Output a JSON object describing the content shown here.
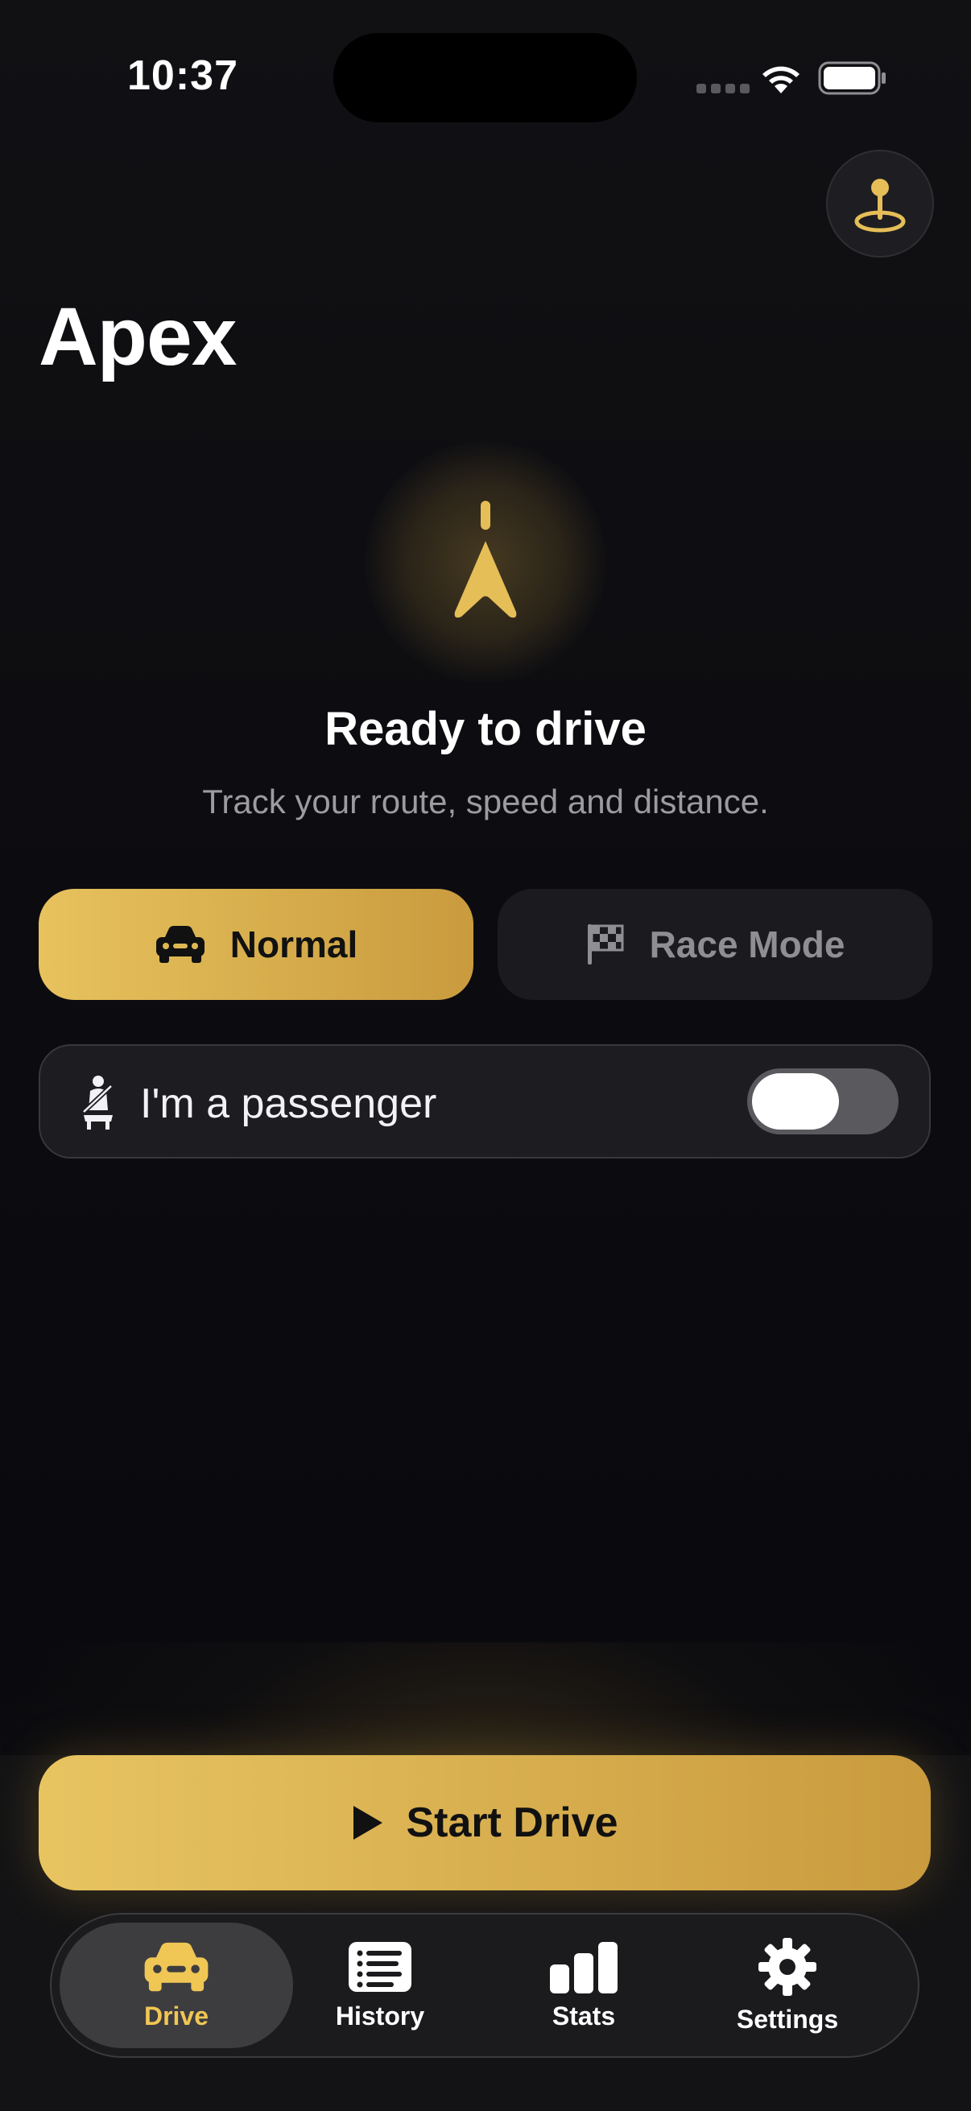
{
  "status_bar": {
    "time": "10:37",
    "icons": [
      "cellular-signal-icon",
      "wifi-icon",
      "battery-icon"
    ]
  },
  "header": {
    "app_title": "Apex",
    "map_button_icon": "map-pin-icon"
  },
  "hero": {
    "icon": "navigation-arrow-icon",
    "title": "Ready to drive",
    "subtitle": "Track your route, speed and distance."
  },
  "mode_selector": {
    "options": [
      {
        "label": "Normal",
        "icon": "car-icon",
        "selected": true
      },
      {
        "label": "Race Mode",
        "icon": "checkered-flag-icon",
        "selected": false
      }
    ]
  },
  "passenger": {
    "label": "I'm a passenger",
    "icon": "seatbelt-icon",
    "enabled": false
  },
  "start_button": {
    "label": "Start Drive",
    "icon": "play-icon"
  },
  "tabbar": {
    "tabs": [
      {
        "label": "Drive",
        "icon": "car-icon",
        "active": true
      },
      {
        "label": "History",
        "icon": "list-icon",
        "active": false
      },
      {
        "label": "Stats",
        "icon": "bar-chart-icon",
        "active": false
      },
      {
        "label": "Settings",
        "icon": "gear-icon",
        "active": false
      }
    ]
  },
  "colors": {
    "accent": "#E5BE58",
    "accent_dark": "#C99B3E",
    "background": "#0B0B0E",
    "surface": "#1D1D21",
    "muted_text": "#9B9BA0"
  }
}
